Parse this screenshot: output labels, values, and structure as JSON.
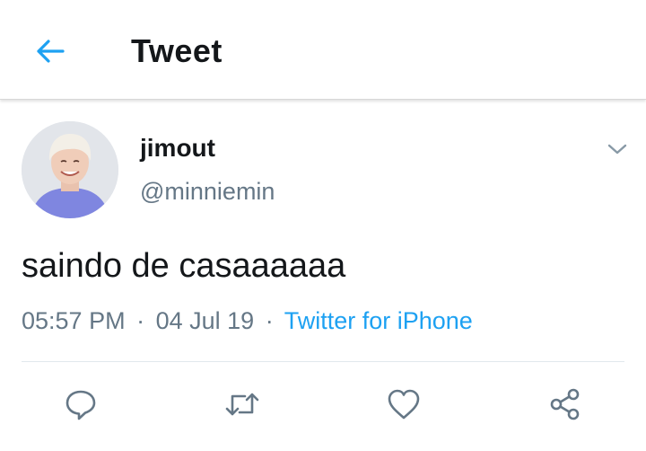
{
  "header": {
    "title": "Tweet",
    "back_icon": "arrow-left-icon"
  },
  "tweet": {
    "author_name": "jimout",
    "author_handle": "@minniemin",
    "text": "saindo de casaaaaaa",
    "time": "05:57 PM",
    "date": "04 Jul 19",
    "source": "Twitter for iPhone",
    "separator": "·"
  },
  "actions": [
    {
      "name": "reply",
      "icon": "reply-icon"
    },
    {
      "name": "retweet",
      "icon": "retweet-icon"
    },
    {
      "name": "like",
      "icon": "heart-icon"
    },
    {
      "name": "share",
      "icon": "share-icon"
    }
  ],
  "colors": {
    "accent": "#1da1f2",
    "secondary_text": "#657786",
    "icon_gray": "#657786",
    "primary_text": "#14171a"
  }
}
